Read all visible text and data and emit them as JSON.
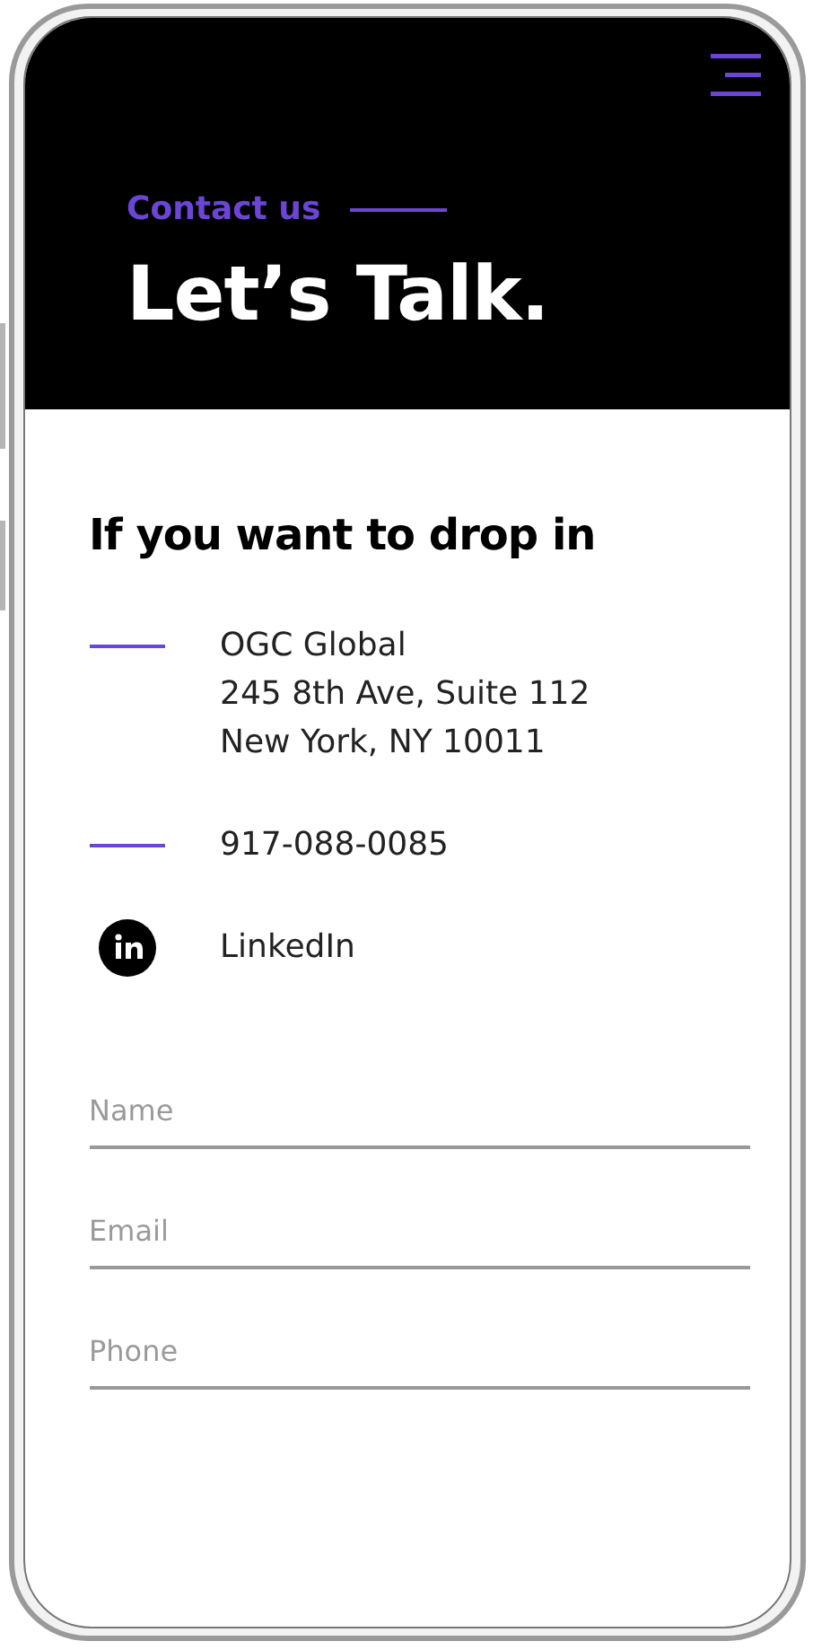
{
  "header": {
    "eyebrow": "Contact us",
    "title": "Let’s Talk."
  },
  "section": {
    "heading": "If you want to drop in",
    "contacts": [
      {
        "kind": "dash",
        "lines": [
          "OGC Global",
          "245 8th Ave, Suite 112",
          "New York, NY 10011"
        ]
      },
      {
        "kind": "dash",
        "lines": [
          "917-088-0085"
        ]
      },
      {
        "kind": "linkedin",
        "lines": [
          "LinkedIn"
        ]
      }
    ]
  },
  "form": {
    "fields": [
      {
        "placeholder": "Name"
      },
      {
        "placeholder": "Email"
      },
      {
        "placeholder": "Phone"
      }
    ]
  }
}
